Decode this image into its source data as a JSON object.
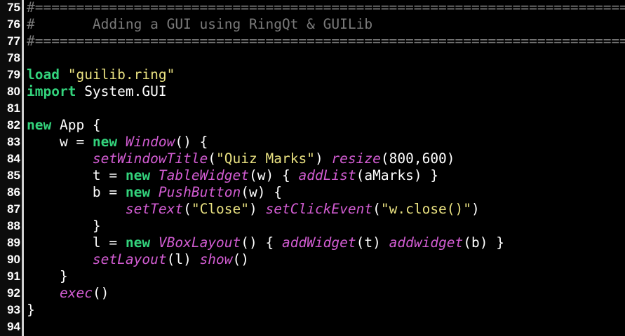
{
  "editor": {
    "colors": {
      "background": "#000000",
      "line_number": "#ffffff",
      "comment": "#7a7a7a",
      "keyword": "#33d37c",
      "string": "#e8e080",
      "function": "#d25cd2",
      "text": "#ffffff"
    },
    "lines": [
      {
        "num": "75",
        "tokens": [
          {
            "t": "comment",
            "v": "#=================================================================================#"
          }
        ]
      },
      {
        "num": "76",
        "tokens": [
          {
            "t": "comment",
            "v": "#       Adding a GUI using RingQt & GUILib"
          }
        ]
      },
      {
        "num": "77",
        "tokens": [
          {
            "t": "comment",
            "v": "#=================================================================================#"
          }
        ]
      },
      {
        "num": "78",
        "tokens": []
      },
      {
        "num": "79",
        "tokens": [
          {
            "t": "keyword",
            "v": "load"
          },
          {
            "t": "plain",
            "v": " "
          },
          {
            "t": "string",
            "v": "\"guilib.ring\""
          }
        ]
      },
      {
        "num": "80",
        "tokens": [
          {
            "t": "keyword",
            "v": "import"
          },
          {
            "t": "plain",
            "v": " System.GUI"
          }
        ]
      },
      {
        "num": "81",
        "tokens": []
      },
      {
        "num": "82",
        "tokens": [
          {
            "t": "keyword",
            "v": "new"
          },
          {
            "t": "plain",
            "v": " App {"
          }
        ]
      },
      {
        "num": "83",
        "tokens": [
          {
            "t": "plain",
            "v": "    w = "
          },
          {
            "t": "keyword",
            "v": "new"
          },
          {
            "t": "plain",
            "v": " "
          },
          {
            "t": "func",
            "v": "Window"
          },
          {
            "t": "plain",
            "v": "() {"
          }
        ]
      },
      {
        "num": "84",
        "tokens": [
          {
            "t": "plain",
            "v": "        "
          },
          {
            "t": "func",
            "v": "setWindowTitle"
          },
          {
            "t": "plain",
            "v": "("
          },
          {
            "t": "string",
            "v": "\"Quiz Marks\""
          },
          {
            "t": "plain",
            "v": ") "
          },
          {
            "t": "func",
            "v": "resize"
          },
          {
            "t": "plain",
            "v": "(800,600)"
          }
        ]
      },
      {
        "num": "85",
        "tokens": [
          {
            "t": "plain",
            "v": "        t = "
          },
          {
            "t": "keyword",
            "v": "new"
          },
          {
            "t": "plain",
            "v": " "
          },
          {
            "t": "func",
            "v": "TableWidget"
          },
          {
            "t": "plain",
            "v": "(w) { "
          },
          {
            "t": "func",
            "v": "addList"
          },
          {
            "t": "plain",
            "v": "(aMarks) }"
          }
        ]
      },
      {
        "num": "86",
        "tokens": [
          {
            "t": "plain",
            "v": "        b = "
          },
          {
            "t": "keyword",
            "v": "new"
          },
          {
            "t": "plain",
            "v": " "
          },
          {
            "t": "func",
            "v": "PushButton"
          },
          {
            "t": "plain",
            "v": "(w) {"
          }
        ]
      },
      {
        "num": "87",
        "tokens": [
          {
            "t": "plain",
            "v": "            "
          },
          {
            "t": "func",
            "v": "setText"
          },
          {
            "t": "plain",
            "v": "("
          },
          {
            "t": "string",
            "v": "\"Close\""
          },
          {
            "t": "plain",
            "v": ") "
          },
          {
            "t": "func",
            "v": "setClickEvent"
          },
          {
            "t": "plain",
            "v": "("
          },
          {
            "t": "string",
            "v": "\"w.close()\""
          },
          {
            "t": "plain",
            "v": ")"
          }
        ]
      },
      {
        "num": "88",
        "tokens": [
          {
            "t": "plain",
            "v": "        }"
          }
        ]
      },
      {
        "num": "89",
        "tokens": [
          {
            "t": "plain",
            "v": "        l = "
          },
          {
            "t": "keyword",
            "v": "new"
          },
          {
            "t": "plain",
            "v": " "
          },
          {
            "t": "func",
            "v": "VBoxLayout"
          },
          {
            "t": "plain",
            "v": "() { "
          },
          {
            "t": "func",
            "v": "addWidget"
          },
          {
            "t": "plain",
            "v": "(t) "
          },
          {
            "t": "func",
            "v": "addwidget"
          },
          {
            "t": "plain",
            "v": "(b) }"
          }
        ]
      },
      {
        "num": "90",
        "tokens": [
          {
            "t": "plain",
            "v": "        "
          },
          {
            "t": "func",
            "v": "setLayout"
          },
          {
            "t": "plain",
            "v": "(l) "
          },
          {
            "t": "func",
            "v": "show"
          },
          {
            "t": "plain",
            "v": "()"
          }
        ]
      },
      {
        "num": "91",
        "tokens": [
          {
            "t": "plain",
            "v": "    }"
          }
        ]
      },
      {
        "num": "92",
        "tokens": [
          {
            "t": "plain",
            "v": "    "
          },
          {
            "t": "func",
            "v": "exec"
          },
          {
            "t": "plain",
            "v": "()"
          }
        ]
      },
      {
        "num": "93",
        "tokens": [
          {
            "t": "plain",
            "v": "}"
          }
        ]
      },
      {
        "num": "94",
        "tokens": []
      }
    ]
  }
}
